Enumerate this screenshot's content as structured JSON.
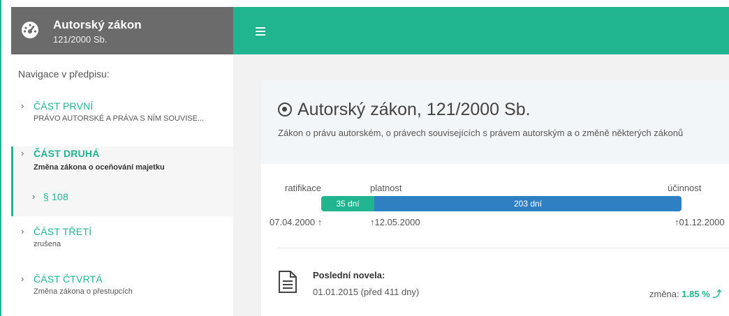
{
  "header": {
    "title": "Autorský zákon",
    "subtitle": "121/2000 Sb.",
    "menu_icon": "hamburger-icon",
    "logo_icon": "dashboard-gauge-icon"
  },
  "sidebar": {
    "heading": "Navigace v předpisu:",
    "items": [
      {
        "title": "ČÁST PRVNÍ",
        "subtitle": "PRÁVO AUTORSKÉ A PRÁVA S NÍM SOUVISE..."
      },
      {
        "title": "ČÁST DRUHÁ",
        "subtitle": "Změna zákona o oceňování majetku",
        "active": true
      },
      {
        "title": "§ 108"
      },
      {
        "title": "ČÁST TŘETÍ",
        "subtitle": "zrušena"
      },
      {
        "title": "ČÁST ČTVRTÁ",
        "subtitle": "Změna zákona o přestupcích"
      }
    ]
  },
  "main": {
    "title": "Autorský zákon, 121/2000 Sb.",
    "description": "Zákon o právu autorském, o právech souvisejících s právem autorským a o změně některých zákonů",
    "timeline": {
      "labels": {
        "ratifikace": "ratifikace",
        "platnost": "platnost",
        "ucinnost": "účinnost"
      },
      "green_label": "35 dní",
      "blue_label": "203 dní",
      "dates": {
        "ratifikace": "07.04.2000",
        "platnost": "12.05.2000",
        "ucinnost": "01.12.2000"
      }
    },
    "novela": {
      "label": "Poslední novela:",
      "date": "01.01.2015 (před 411 dny)",
      "change_label": "změna:",
      "change_value": "1.85 %"
    }
  },
  "colors": {
    "accent": "#20b48f",
    "blue": "#2f7fc3",
    "brand_bg": "#6b6b6b"
  }
}
